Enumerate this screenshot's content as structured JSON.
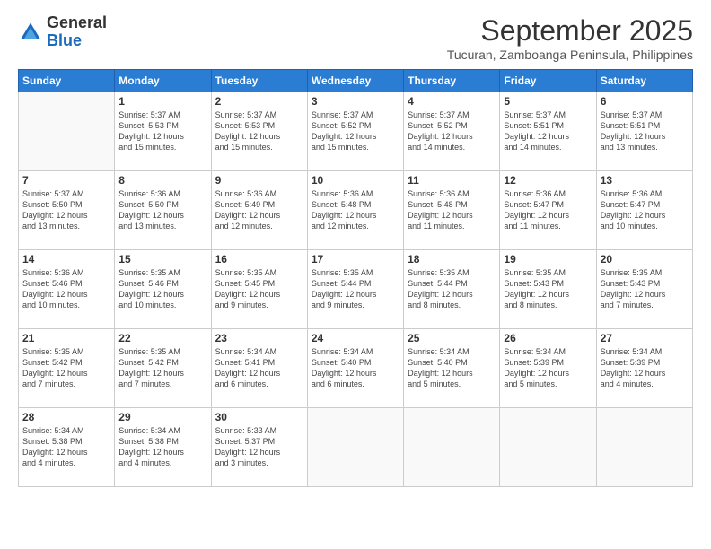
{
  "header": {
    "logo_general": "General",
    "logo_blue": "Blue",
    "title": "September 2025",
    "subtitle": "Tucuran, Zamboanga Peninsula, Philippines"
  },
  "days_of_week": [
    "Sunday",
    "Monday",
    "Tuesday",
    "Wednesday",
    "Thursday",
    "Friday",
    "Saturday"
  ],
  "weeks": [
    [
      {
        "num": "",
        "info": ""
      },
      {
        "num": "1",
        "info": "Sunrise: 5:37 AM\nSunset: 5:53 PM\nDaylight: 12 hours\nand 15 minutes."
      },
      {
        "num": "2",
        "info": "Sunrise: 5:37 AM\nSunset: 5:53 PM\nDaylight: 12 hours\nand 15 minutes."
      },
      {
        "num": "3",
        "info": "Sunrise: 5:37 AM\nSunset: 5:52 PM\nDaylight: 12 hours\nand 15 minutes."
      },
      {
        "num": "4",
        "info": "Sunrise: 5:37 AM\nSunset: 5:52 PM\nDaylight: 12 hours\nand 14 minutes."
      },
      {
        "num": "5",
        "info": "Sunrise: 5:37 AM\nSunset: 5:51 PM\nDaylight: 12 hours\nand 14 minutes."
      },
      {
        "num": "6",
        "info": "Sunrise: 5:37 AM\nSunset: 5:51 PM\nDaylight: 12 hours\nand 13 minutes."
      }
    ],
    [
      {
        "num": "7",
        "info": "Sunrise: 5:37 AM\nSunset: 5:50 PM\nDaylight: 12 hours\nand 13 minutes."
      },
      {
        "num": "8",
        "info": "Sunrise: 5:36 AM\nSunset: 5:50 PM\nDaylight: 12 hours\nand 13 minutes."
      },
      {
        "num": "9",
        "info": "Sunrise: 5:36 AM\nSunset: 5:49 PM\nDaylight: 12 hours\nand 12 minutes."
      },
      {
        "num": "10",
        "info": "Sunrise: 5:36 AM\nSunset: 5:48 PM\nDaylight: 12 hours\nand 12 minutes."
      },
      {
        "num": "11",
        "info": "Sunrise: 5:36 AM\nSunset: 5:48 PM\nDaylight: 12 hours\nand 11 minutes."
      },
      {
        "num": "12",
        "info": "Sunrise: 5:36 AM\nSunset: 5:47 PM\nDaylight: 12 hours\nand 11 minutes."
      },
      {
        "num": "13",
        "info": "Sunrise: 5:36 AM\nSunset: 5:47 PM\nDaylight: 12 hours\nand 10 minutes."
      }
    ],
    [
      {
        "num": "14",
        "info": "Sunrise: 5:36 AM\nSunset: 5:46 PM\nDaylight: 12 hours\nand 10 minutes."
      },
      {
        "num": "15",
        "info": "Sunrise: 5:35 AM\nSunset: 5:46 PM\nDaylight: 12 hours\nand 10 minutes."
      },
      {
        "num": "16",
        "info": "Sunrise: 5:35 AM\nSunset: 5:45 PM\nDaylight: 12 hours\nand 9 minutes."
      },
      {
        "num": "17",
        "info": "Sunrise: 5:35 AM\nSunset: 5:44 PM\nDaylight: 12 hours\nand 9 minutes."
      },
      {
        "num": "18",
        "info": "Sunrise: 5:35 AM\nSunset: 5:44 PM\nDaylight: 12 hours\nand 8 minutes."
      },
      {
        "num": "19",
        "info": "Sunrise: 5:35 AM\nSunset: 5:43 PM\nDaylight: 12 hours\nand 8 minutes."
      },
      {
        "num": "20",
        "info": "Sunrise: 5:35 AM\nSunset: 5:43 PM\nDaylight: 12 hours\nand 7 minutes."
      }
    ],
    [
      {
        "num": "21",
        "info": "Sunrise: 5:35 AM\nSunset: 5:42 PM\nDaylight: 12 hours\nand 7 minutes."
      },
      {
        "num": "22",
        "info": "Sunrise: 5:35 AM\nSunset: 5:42 PM\nDaylight: 12 hours\nand 7 minutes."
      },
      {
        "num": "23",
        "info": "Sunrise: 5:34 AM\nSunset: 5:41 PM\nDaylight: 12 hours\nand 6 minutes."
      },
      {
        "num": "24",
        "info": "Sunrise: 5:34 AM\nSunset: 5:40 PM\nDaylight: 12 hours\nand 6 minutes."
      },
      {
        "num": "25",
        "info": "Sunrise: 5:34 AM\nSunset: 5:40 PM\nDaylight: 12 hours\nand 5 minutes."
      },
      {
        "num": "26",
        "info": "Sunrise: 5:34 AM\nSunset: 5:39 PM\nDaylight: 12 hours\nand 5 minutes."
      },
      {
        "num": "27",
        "info": "Sunrise: 5:34 AM\nSunset: 5:39 PM\nDaylight: 12 hours\nand 4 minutes."
      }
    ],
    [
      {
        "num": "28",
        "info": "Sunrise: 5:34 AM\nSunset: 5:38 PM\nDaylight: 12 hours\nand 4 minutes."
      },
      {
        "num": "29",
        "info": "Sunrise: 5:34 AM\nSunset: 5:38 PM\nDaylight: 12 hours\nand 4 minutes."
      },
      {
        "num": "30",
        "info": "Sunrise: 5:33 AM\nSunset: 5:37 PM\nDaylight: 12 hours\nand 3 minutes."
      },
      {
        "num": "",
        "info": ""
      },
      {
        "num": "",
        "info": ""
      },
      {
        "num": "",
        "info": ""
      },
      {
        "num": "",
        "info": ""
      }
    ]
  ]
}
